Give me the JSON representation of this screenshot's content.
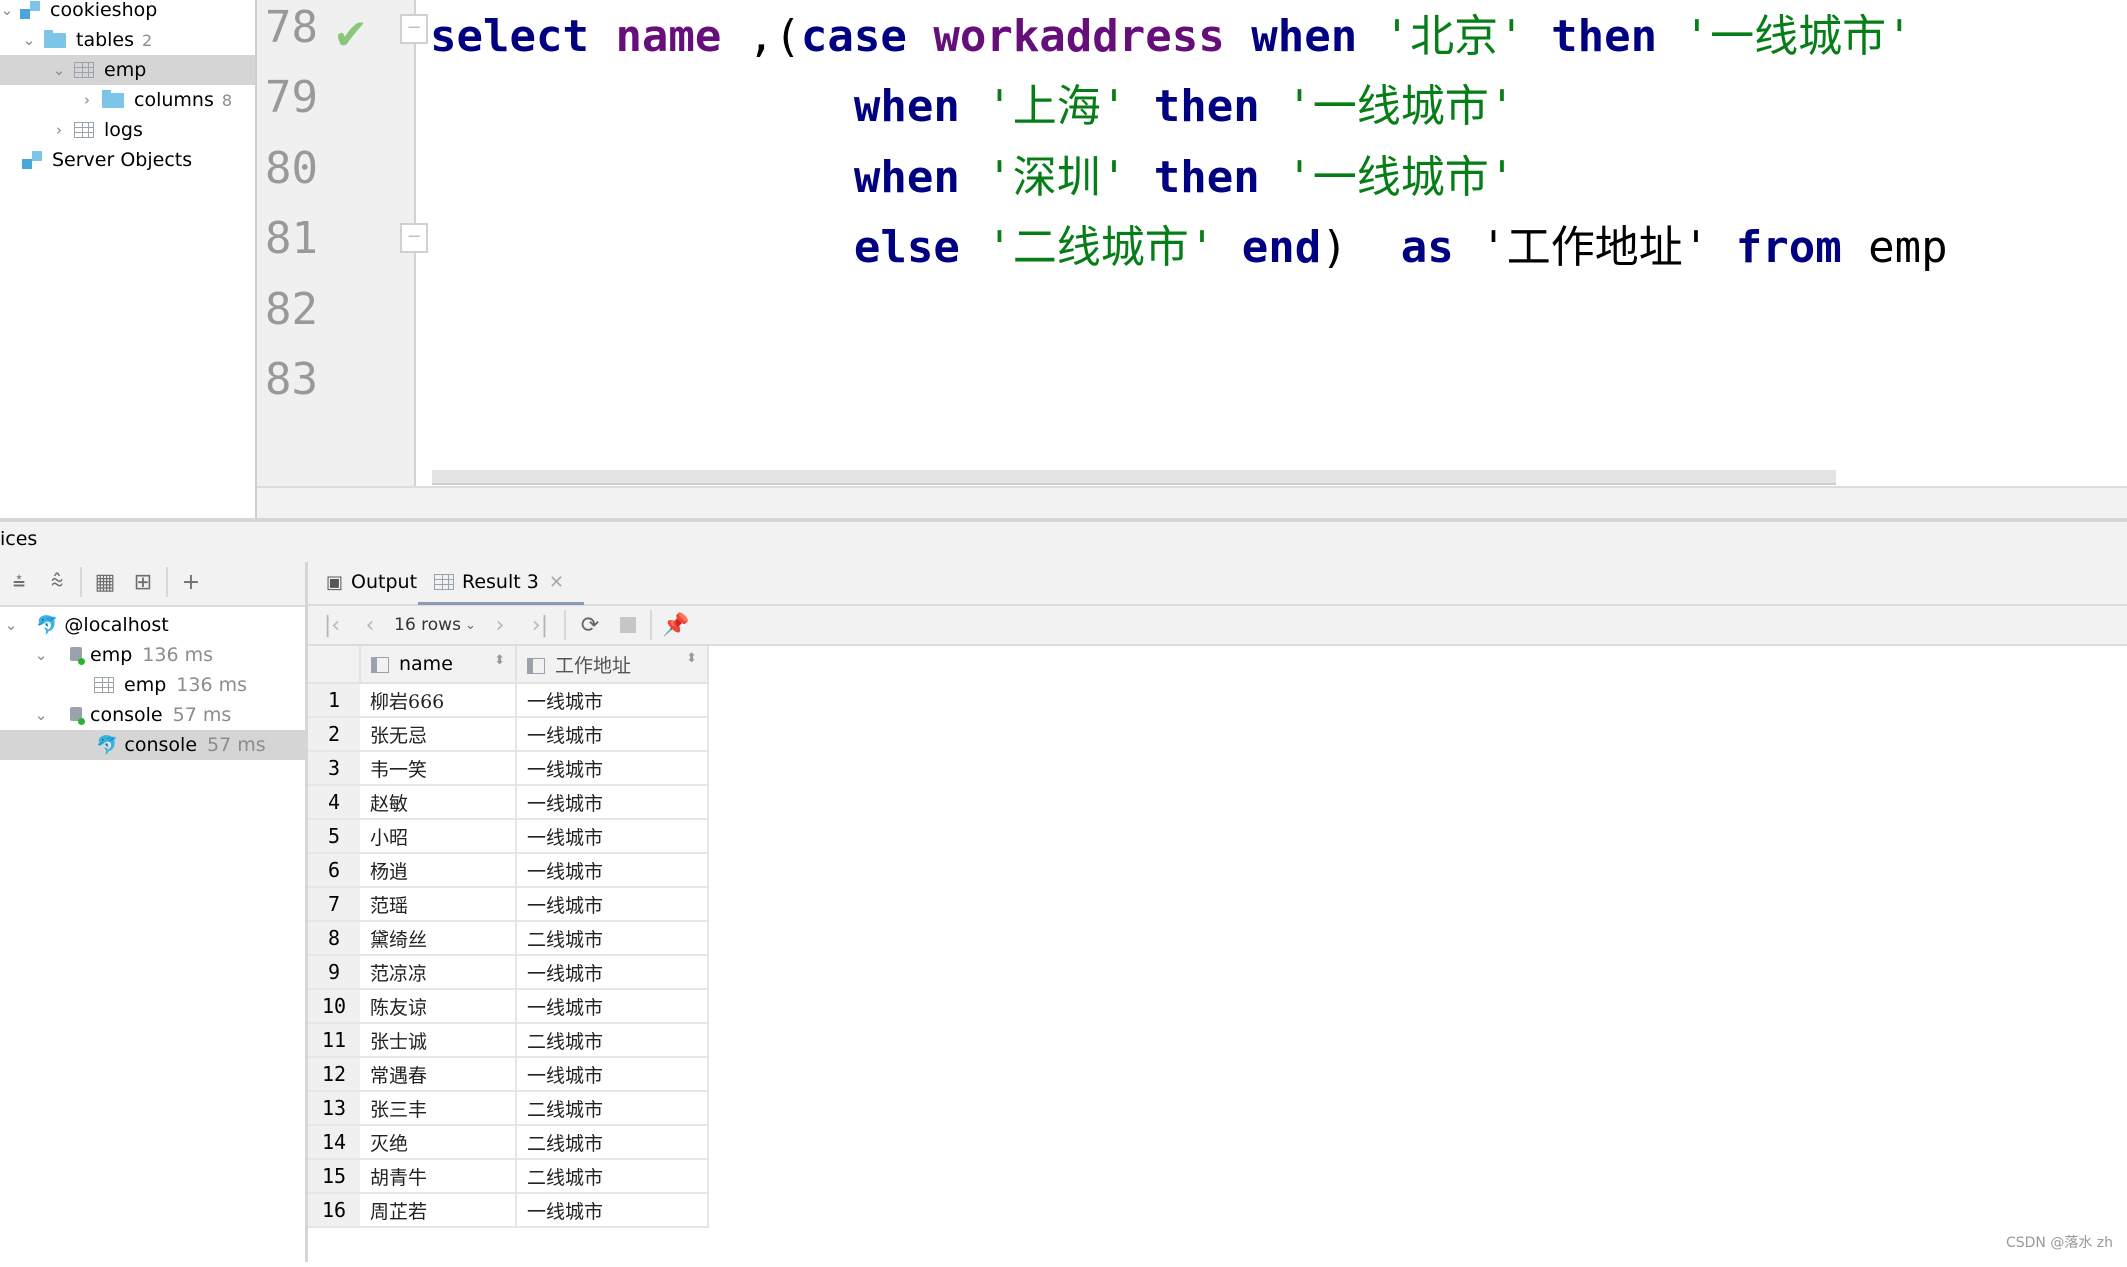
{
  "db_tree": {
    "items": [
      {
        "label": "cookieshop",
        "count": "",
        "level": 0
      },
      {
        "label": "tables",
        "count": "2",
        "level": 1
      },
      {
        "label": "emp",
        "count": "",
        "level": 2
      },
      {
        "label": "columns",
        "count": "8",
        "level": 3
      },
      {
        "label": "logs",
        "count": "",
        "level": 2
      },
      {
        "label": "Server Objects",
        "count": "",
        "level": 0
      }
    ]
  },
  "editor": {
    "line_numbers": [
      "78",
      "79",
      "80",
      "81",
      "82",
      "83"
    ],
    "status_icon": "check-icon",
    "lines": [
      [
        {
          "t": "select ",
          "c": "kw"
        },
        {
          "t": "name",
          "c": "id"
        },
        {
          "t": " ,(",
          "c": "pl"
        },
        {
          "t": "case ",
          "c": "kw"
        },
        {
          "t": "workaddress ",
          "c": "id"
        },
        {
          "t": "when ",
          "c": "kw"
        },
        {
          "t": "'北京' ",
          "c": "str"
        },
        {
          "t": "then ",
          "c": "kw"
        },
        {
          "t": "'一线城市'",
          "c": "str"
        }
      ],
      [
        {
          "t": "                ",
          "c": "pl"
        },
        {
          "t": "when ",
          "c": "kw"
        },
        {
          "t": "'上海' ",
          "c": "str"
        },
        {
          "t": "then ",
          "c": "kw"
        },
        {
          "t": "'一线城市'",
          "c": "str"
        }
      ],
      [
        {
          "t": "                ",
          "c": "pl"
        },
        {
          "t": "when ",
          "c": "kw"
        },
        {
          "t": "'深圳' ",
          "c": "str"
        },
        {
          "t": "then ",
          "c": "kw"
        },
        {
          "t": "'一线城市'",
          "c": "str"
        }
      ],
      [
        {
          "t": "                ",
          "c": "pl"
        },
        {
          "t": "else ",
          "c": "kw"
        },
        {
          "t": "'二线城市' ",
          "c": "str"
        },
        {
          "t": "end",
          "c": "kw"
        },
        {
          "t": ")  ",
          "c": "pl"
        },
        {
          "t": "as ",
          "c": "kw"
        },
        {
          "t": "'工作地址' ",
          "c": "pl"
        },
        {
          "t": "from ",
          "c": "kw"
        },
        {
          "t": "emp",
          "c": "pl"
        }
      ],
      [],
      []
    ],
    "colors": {
      "keyword": "#000080",
      "identifier": "#660e7a",
      "string": "#067d17"
    }
  },
  "services": {
    "title": "ices",
    "toolbar": [
      "expand-all-icon",
      "collapse-all-icon",
      "group-icon",
      "new-session-icon",
      "add-icon"
    ],
    "tree": [
      {
        "label": "@localhost",
        "time": "",
        "level": 0,
        "icon": "mysql-dolphin-icon"
      },
      {
        "label": "emp",
        "time": "136 ms",
        "level": 1,
        "icon": "connection-icon"
      },
      {
        "label": "emp",
        "time": "136 ms",
        "level": 2,
        "icon": "table-icon"
      },
      {
        "label": "console",
        "time": "57 ms",
        "level": 1,
        "icon": "connection-icon"
      },
      {
        "label": "console",
        "time": "57 ms",
        "level": 2,
        "icon": "mysql-dolphin-icon"
      }
    ]
  },
  "results": {
    "tabs": [
      {
        "label": "Output"
      },
      {
        "label": "Result 3",
        "active": true
      }
    ],
    "rows_label": "16 rows",
    "columns": [
      "name",
      "工作地址"
    ],
    "rows": [
      [
        "柳岩666",
        "一线城市"
      ],
      [
        "张无忌",
        "一线城市"
      ],
      [
        "韦一笑",
        "一线城市"
      ],
      [
        "赵敏",
        "一线城市"
      ],
      [
        "小昭",
        "一线城市"
      ],
      [
        "杨逍",
        "一线城市"
      ],
      [
        "范瑶",
        "一线城市"
      ],
      [
        "黛绮丝",
        "二线城市"
      ],
      [
        "范凉凉",
        "一线城市"
      ],
      [
        "陈友谅",
        "一线城市"
      ],
      [
        "张士诚",
        "二线城市"
      ],
      [
        "常遇春",
        "一线城市"
      ],
      [
        "张三丰",
        "二线城市"
      ],
      [
        "灭绝",
        "二线城市"
      ],
      [
        "胡青牛",
        "二线城市"
      ],
      [
        "周芷若",
        "一线城市"
      ]
    ]
  },
  "watermark": "CSDN @落水 zh"
}
